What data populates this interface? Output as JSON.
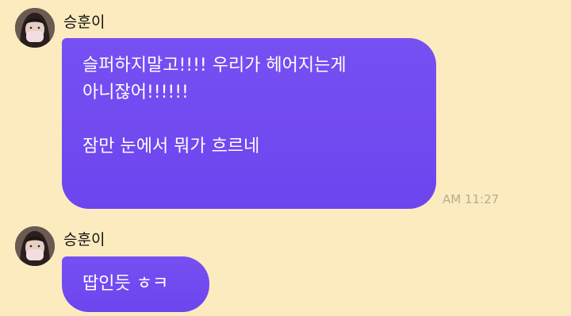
{
  "chat": {
    "messages": [
      {
        "sender": "승훈이",
        "avatar_icon": "profile-photo-icon",
        "lines": [
          "슬퍼하지말고!!!! 우리가 헤어지는게",
          "아니잖어!!!!!!",
          "",
          "잠만 눈에서 뭐가 흐르네"
        ],
        "time": "AM 11:27"
      },
      {
        "sender": "승훈이",
        "avatar_icon": "profile-photo-icon",
        "lines": [
          "땁인듯 ㅎㅋ"
        ],
        "time": ""
      }
    ]
  },
  "colors": {
    "background": "#fcebbf",
    "bubble": "#7048f0",
    "bubble_text": "#ffffff",
    "timestamp": "#b9ad8e"
  }
}
